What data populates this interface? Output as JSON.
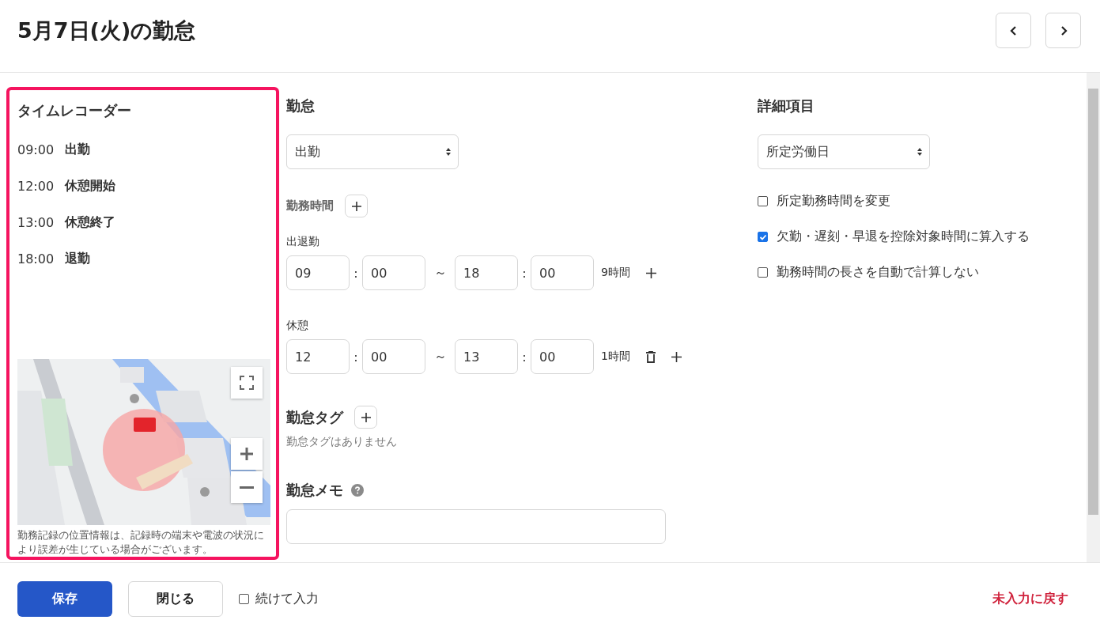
{
  "header": {
    "title": "5月7日(火)の勤怠"
  },
  "time_recorder": {
    "title": "タイムレコーダー",
    "entries": [
      {
        "time": "09:00",
        "label": "出勤"
      },
      {
        "time": "12:00",
        "label": "休憩開始"
      },
      {
        "time": "13:00",
        "label": "休憩終了"
      },
      {
        "time": "18:00",
        "label": "退勤"
      }
    ],
    "note": "勤務記録の位置情報は、記録時の端末や電波の状況により誤差が生じている場合がございます。"
  },
  "attendance": {
    "heading": "勤怠",
    "select_value": "出勤",
    "work_time_heading": "勤務時間",
    "groups": [
      {
        "label": "出退勤",
        "start_hour": "09",
        "colon_1": ":",
        "start_minute": "00",
        "tilde": "～",
        "end_hour": "18",
        "colon_2": ":",
        "end_minute": "00",
        "duration": "9時間",
        "deletable": false
      },
      {
        "label": "休憩",
        "start_hour": "12",
        "colon_1": ":",
        "start_minute": "00",
        "tilde": "～",
        "end_hour": "13",
        "colon_2": ":",
        "end_minute": "00",
        "duration": "1時間",
        "deletable": true
      }
    ],
    "tag_heading": "勤怠タグ",
    "tag_empty": "勤怠タグはありません",
    "memo_heading": "勤怠メモ"
  },
  "details": {
    "heading": "詳細項目",
    "select_value": "所定労働日",
    "options": [
      {
        "label": "所定勤務時間を変更",
        "checked": false
      },
      {
        "label": "欠勤・遅刻・早退を控除対象時間に算入する",
        "checked": true
      },
      {
        "label": "勤務時間の長さを自動で計算しない",
        "checked": false
      }
    ]
  },
  "footer": {
    "save": "保存",
    "close": "閉じる",
    "continue": {
      "label": "続けて入力",
      "checked": false
    },
    "reset": "未入力に戻す"
  }
}
